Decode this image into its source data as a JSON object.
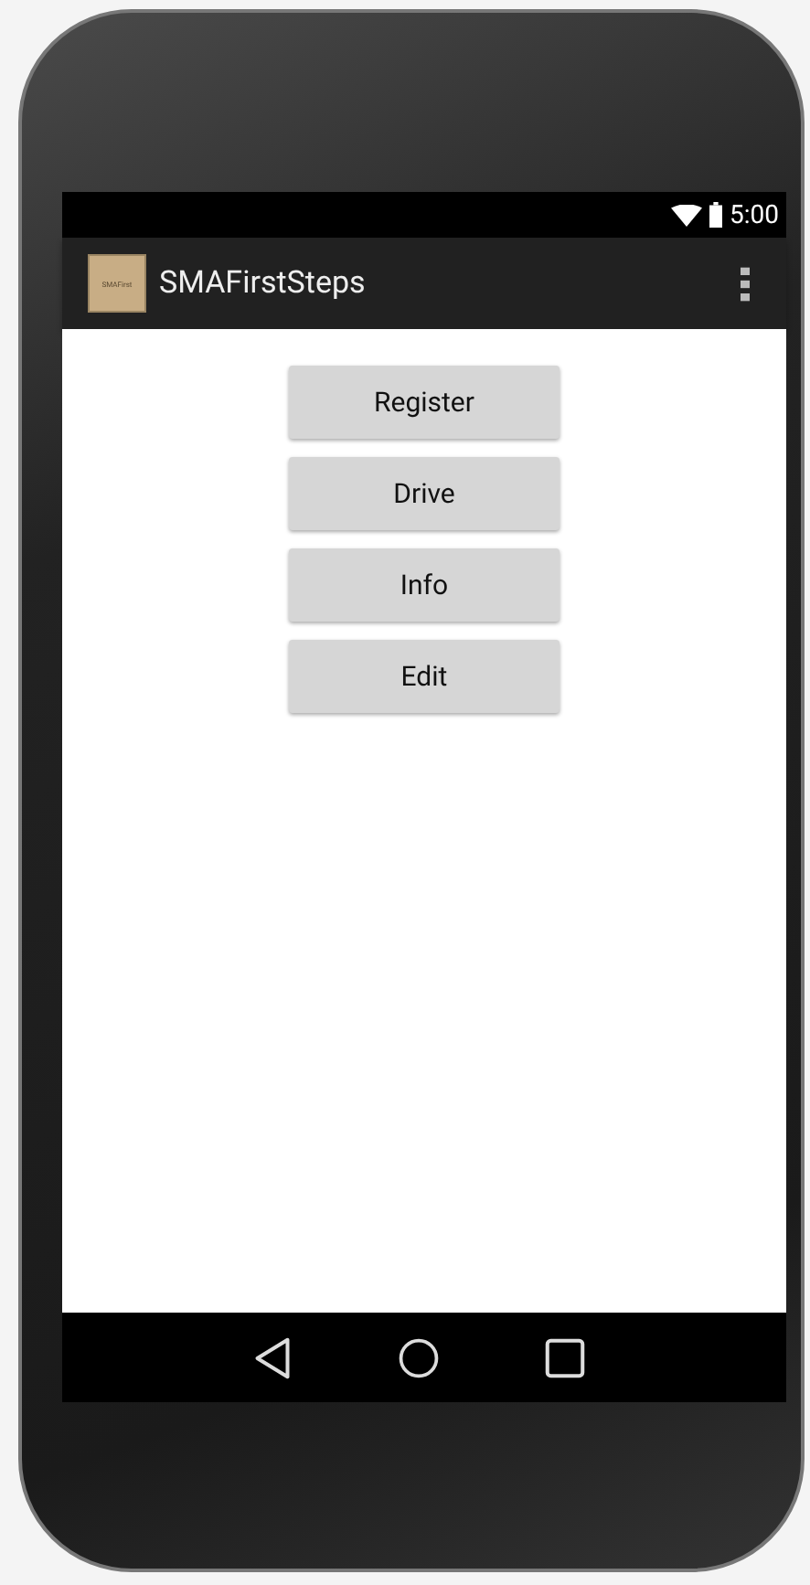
{
  "status_bar": {
    "time": "5:00"
  },
  "action_bar": {
    "app_icon_text": "SMAFirst",
    "title": "SMAFirstSteps"
  },
  "buttons": [
    {
      "label": "Register"
    },
    {
      "label": "Drive"
    },
    {
      "label": "Info"
    },
    {
      "label": "Edit"
    }
  ]
}
